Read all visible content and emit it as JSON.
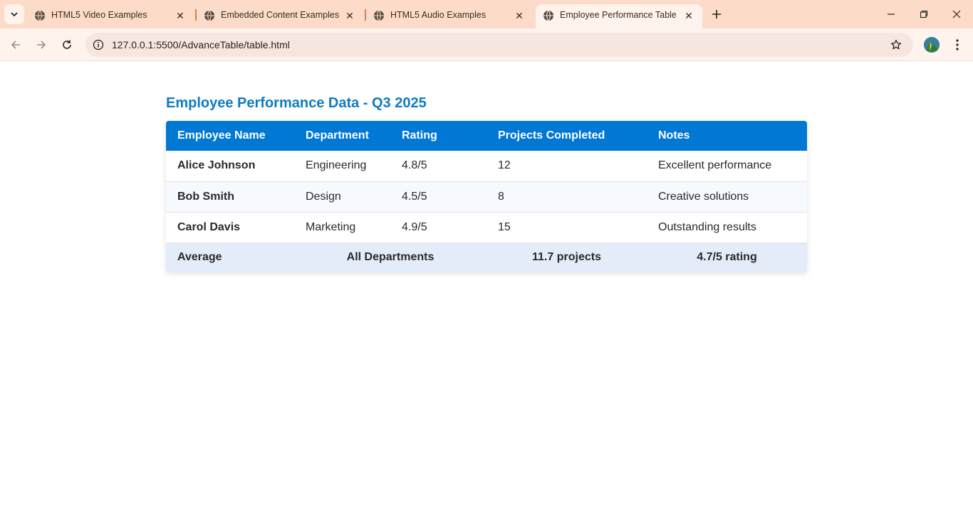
{
  "browser": {
    "tabs": [
      {
        "title": "HTML5 Video Examples",
        "active": false
      },
      {
        "title": "Embedded Content Examples",
        "active": false
      },
      {
        "title": "HTML5 Audio Examples",
        "active": false
      },
      {
        "title": "Employee Performance Table",
        "active": true
      }
    ],
    "url": "127.0.0.1:5500/AdvanceTable/table.html",
    "accent_color": "#fcdcc9"
  },
  "page": {
    "title": "Employee Performance Data - Q3 2025",
    "title_color": "#0d7bc4",
    "header_color": "#0078d4",
    "table": {
      "headers": [
        "Employee Name",
        "Department",
        "Rating",
        "Projects Completed",
        "Notes"
      ],
      "rows": [
        {
          "name": "Alice Johnson",
          "department": "Engineering",
          "rating": "4.8/5",
          "projects": "12",
          "notes": "Excellent performance"
        },
        {
          "name": "Bob Smith",
          "department": "Design",
          "rating": "4.5/5",
          "projects": "8",
          "notes": "Creative solutions"
        },
        {
          "name": "Carol Davis",
          "department": "Marketing",
          "rating": "4.9/5",
          "projects": "15",
          "notes": "Outstanding results"
        }
      ],
      "footer": {
        "label": "Average",
        "departments": "All Departments",
        "projects": "11.7 projects",
        "rating": "4.7/5 rating"
      }
    }
  }
}
